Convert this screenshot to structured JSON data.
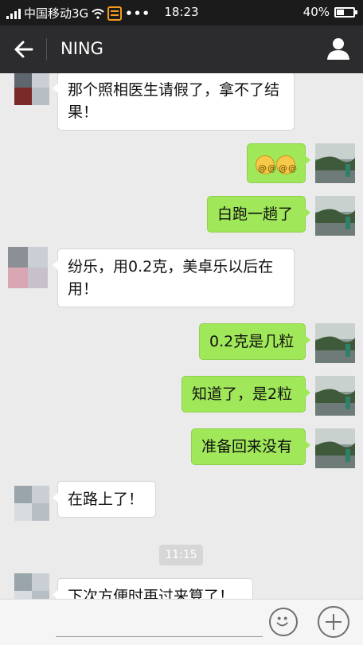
{
  "status_bar": {
    "carrier": "中国移动3G",
    "dots": "•••",
    "time": "18:23",
    "battery": "40%",
    "battery_level": 0.4
  },
  "header": {
    "title": "NING"
  },
  "messages": [
    {
      "from": "contact",
      "text": "那个照相医生请假了，拿不了结果！"
    },
    {
      "from": "me",
      "text": "",
      "emoji": "dizzy-face",
      "emoji_count": 2
    },
    {
      "from": "me",
      "text": "白跑一趟了"
    },
    {
      "from": "contact",
      "text": "纷乐，用0.2克，美卓乐以后在用！"
    },
    {
      "from": "me",
      "text": "0.2克是几粒"
    },
    {
      "from": "me",
      "text": "知道了，是2粒"
    },
    {
      "from": "me",
      "text": "准备回来没有"
    },
    {
      "from": "contact",
      "text": "在路上了！"
    },
    {
      "from": "contact",
      "text": "下次方便时再过来算了！"
    }
  ],
  "time_separator": "11:15",
  "colors": {
    "outgoing_bubble": "#a0e759",
    "incoming_bubble": "#ffffff",
    "chat_background": "#ebebeb",
    "header_background": "#2c2c2e"
  },
  "icons": [
    "back-arrow-icon",
    "profile-icon",
    "emoji-icon",
    "plus-icon",
    "signal-icon",
    "wifi-icon",
    "app-notification-icon",
    "battery-icon"
  ]
}
